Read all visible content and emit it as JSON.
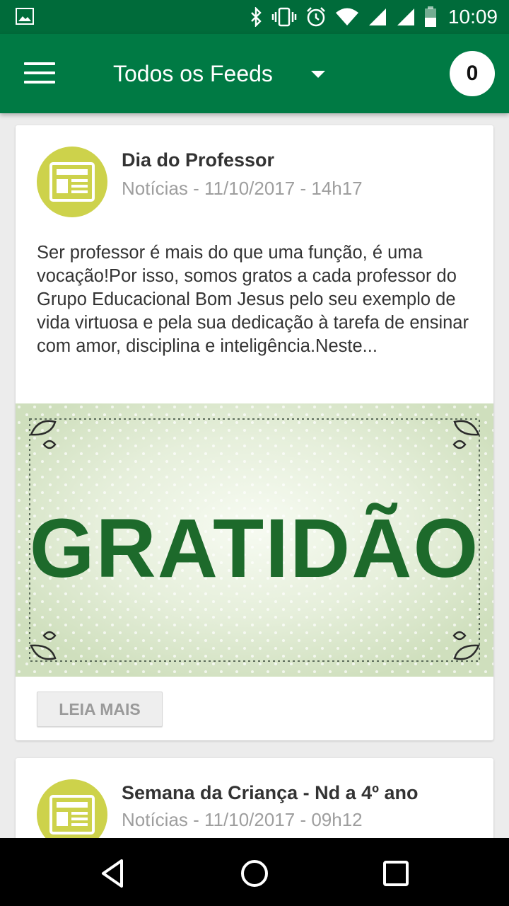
{
  "status_bar": {
    "time": "10:09",
    "icons": [
      "image-icon",
      "bluetooth-icon",
      "vibrate-icon",
      "alarm-icon",
      "wifi-icon",
      "signal-icon",
      "signal-icon",
      "battery-icon"
    ]
  },
  "app_bar": {
    "title": "Todos os Feeds",
    "notification_count": "0"
  },
  "feed": [
    {
      "title": "Dia do Professor",
      "meta": "Notícias - 11/10/2017 - 14h17",
      "body": "Ser professor é mais do que uma função, é uma vocação!Por isso, somos gratos a cada professor do Grupo Educacional Bom Jesus pelo seu exemplo de vida virtuosa e pela sua dedicação à tarefa de ensinar com amor, disciplina e inteligência.Neste...",
      "image_text": "GRATIDÃO",
      "read_more": "LEIA MAIS"
    },
    {
      "title": "Semana da Criança - Nd a 4º ano",
      "meta": "Notícias - 11/10/2017 - 09h12"
    }
  ],
  "colors": {
    "status_bar": "#006b3a",
    "app_bar": "#007a44",
    "avatar": "#cdd24b",
    "image_bg": "#dfead2",
    "image_text": "#1d6a2b"
  }
}
